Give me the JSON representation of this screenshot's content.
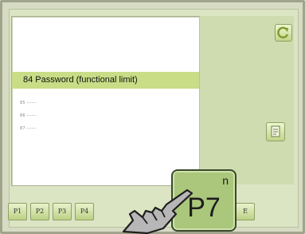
{
  "list": {
    "selected_item": "84 Password (functional limit)",
    "rows": [
      "85 ------",
      "86 ------",
      "87 ------"
    ]
  },
  "tabs": [
    "P1",
    "P2",
    "P3",
    "P4"
  ],
  "right_tab": "E",
  "keypad": {
    "p7_label": "P7",
    "p7_superscript": "n"
  },
  "colors": {
    "screen_bg": "#dbe5c4",
    "highlight": "#c8dd86",
    "key_green": "#aac77c"
  },
  "icons": [
    "refresh-icon",
    "document-icon",
    "hand-pointer-icon"
  ]
}
